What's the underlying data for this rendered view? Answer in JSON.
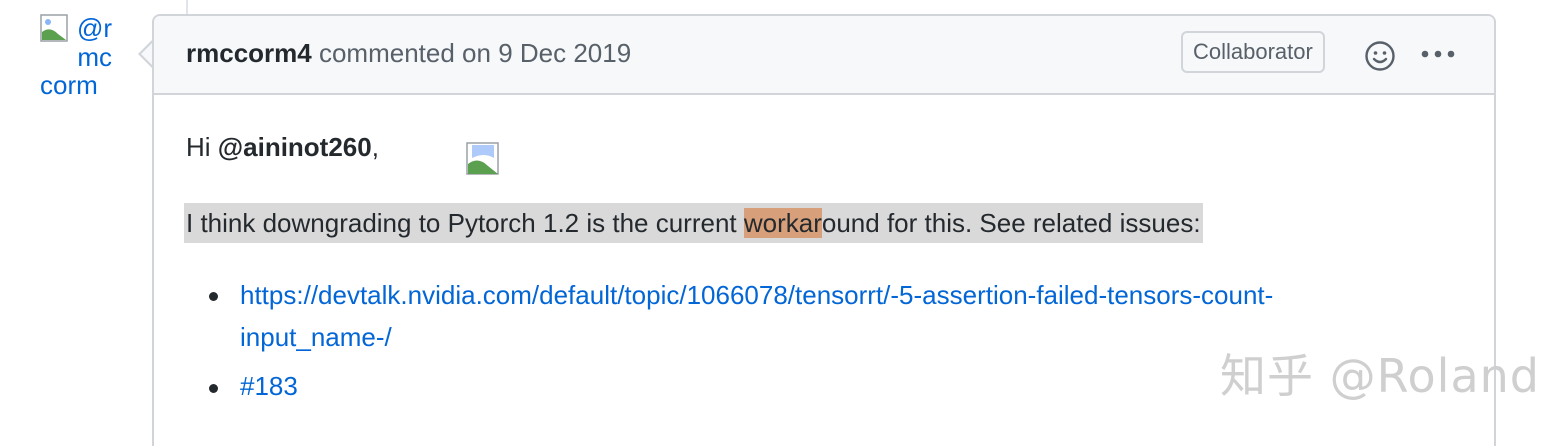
{
  "avatar": {
    "alt_line1": "@r",
    "alt_line2": "mc",
    "alt_line3": "corm",
    "icon": "broken-image-icon"
  },
  "comment": {
    "author": "rmccorm4",
    "action": "commented on",
    "date": "9 Dec 2019",
    "role_badge": "Collaborator",
    "reaction_icon": "smiley-icon",
    "more_icon": "kebab-horizontal-icon"
  },
  "body": {
    "greeting_prefix": "Hi ",
    "greeting_mention": "@aininot260",
    "greeting_suffix": ",",
    "paragraph_before": "I think downgrading to Pytorch 1.2 is the current ",
    "paragraph_highlight": "workar",
    "paragraph_after": "ound for this. See related issues:",
    "links": [
      {
        "line1": "https://devtalk.nvidia.com/default/topic/1066078/tensorrt/-5-assertion-failed-tensors-count-",
        "line2": "input_name-/"
      },
      {
        "line1": "#183"
      }
    ]
  },
  "watermark": "知乎 @Roland",
  "colors": {
    "link": "#0366d6",
    "header_bg": "#f6f8fa",
    "border": "#d1d5da",
    "selection": "#d9d9d9",
    "highlight": "#d7a07a"
  }
}
